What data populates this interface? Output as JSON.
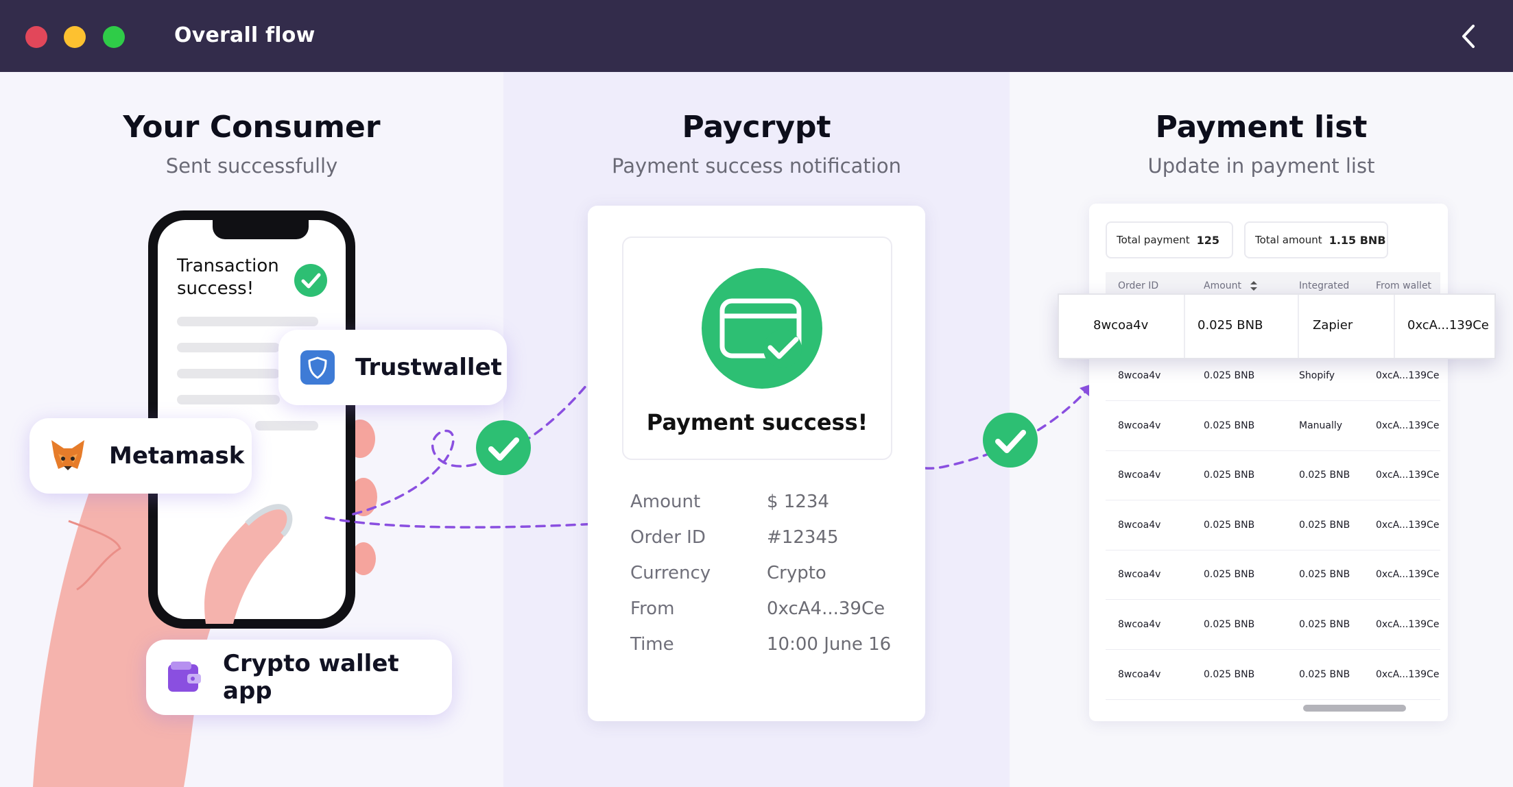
{
  "window": {
    "title": "Overall flow",
    "back_icon": "chevron-left-icon"
  },
  "consumer": {
    "heading": "Your Consumer",
    "subheading": "Sent successfully",
    "phone_text": "Transaction success!",
    "wallets": [
      {
        "name": "Trustwallet",
        "icon": "shield-icon"
      },
      {
        "name": "Metamask",
        "icon": "fox-icon"
      },
      {
        "name": "Crypto wallet app",
        "icon": "wallet-icon"
      }
    ]
  },
  "paycrypt": {
    "heading": "Paycrypt",
    "subheading": "Payment success notification",
    "notification_title": "Payment success!",
    "details": [
      {
        "label": "Amount",
        "value": "$ 1234"
      },
      {
        "label": "Order ID",
        "value": "#12345"
      },
      {
        "label": "Currency",
        "value": "Crypto"
      },
      {
        "label": "From",
        "value": "0xcA4...39Ce"
      },
      {
        "label": "Time",
        "value": "10:00 June 16"
      }
    ]
  },
  "payment_list": {
    "heading": "Payment list",
    "subheading": "Update in payment list",
    "total_payment_label": "Total payment",
    "total_payment_value": "125",
    "total_amount_label": "Total amount",
    "total_amount_value": "1.15 BNB",
    "columns": [
      "Order ID",
      "Amount",
      "Integrated",
      "From wallet"
    ],
    "highlighted_row": [
      "8wcoa4v",
      "0.025 BNB",
      "Zapier",
      "0xcA...139Ce"
    ],
    "rows": [
      [
        "8wcoa4v",
        "0.025 BNB",
        "Shopify",
        "0xcA...139Ce"
      ],
      [
        "8wcoa4v",
        "0.025 BNB",
        "Manually",
        "0xcA...139Ce"
      ],
      [
        "8wcoa4v",
        "0.025 BNB",
        "0.025 BNB",
        "0xcA...139Ce"
      ],
      [
        "8wcoa4v",
        "0.025 BNB",
        "0.025 BNB",
        "0xcA...139Ce"
      ],
      [
        "8wcoa4v",
        "0.025 BNB",
        "0.025 BNB",
        "0xcA...139Ce"
      ],
      [
        "8wcoa4v",
        "0.025 BNB",
        "0.025 BNB",
        "0xcA...139Ce"
      ],
      [
        "8wcoa4v",
        "0.025 BNB",
        "0.025 BNB",
        "0xcA...139Ce"
      ]
    ]
  },
  "colors": {
    "titlebar": "#332c4b",
    "success_green": "#2dbf73",
    "flow_purple": "#8a4fe0"
  }
}
